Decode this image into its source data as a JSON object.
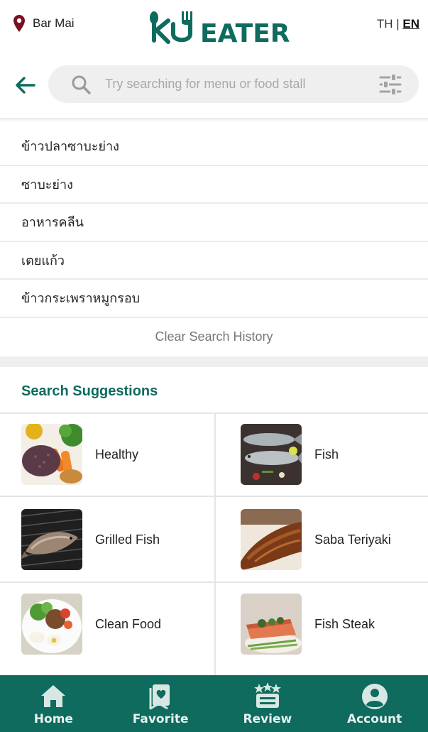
{
  "header": {
    "location": "Bar Mai",
    "brand": "KU EATER",
    "lang_th": "TH",
    "lang_sep": "|",
    "lang_en": "EN"
  },
  "search": {
    "placeholder": "Try searching for menu or food stall",
    "value": ""
  },
  "history": {
    "items": [
      "ข้าวปลาซาบะย่าง",
      "ซาบะย่าง",
      "อาหารคลีน",
      "เตยแก้ว",
      "ข้าวกระเพราหมูกรอบ"
    ],
    "clear_label": "Clear Search History"
  },
  "suggestions": {
    "title": "Search Suggestions",
    "items": [
      "Healthy",
      "Fish",
      "Grilled Fish",
      "Saba Teriyaki",
      "Clean Food",
      "Fish Steak"
    ]
  },
  "nav": {
    "items": [
      "Home",
      "Favorite",
      "Review",
      "Account"
    ]
  },
  "colors": {
    "brand_green": "#0e6b5e",
    "pin_red": "#7a1020",
    "search_bg": "#efefef"
  },
  "icons": [
    "location-pin-icon",
    "back-arrow-icon",
    "search-icon",
    "filter-icon",
    "home-icon",
    "favorite-icon",
    "review-icon",
    "account-icon"
  ]
}
